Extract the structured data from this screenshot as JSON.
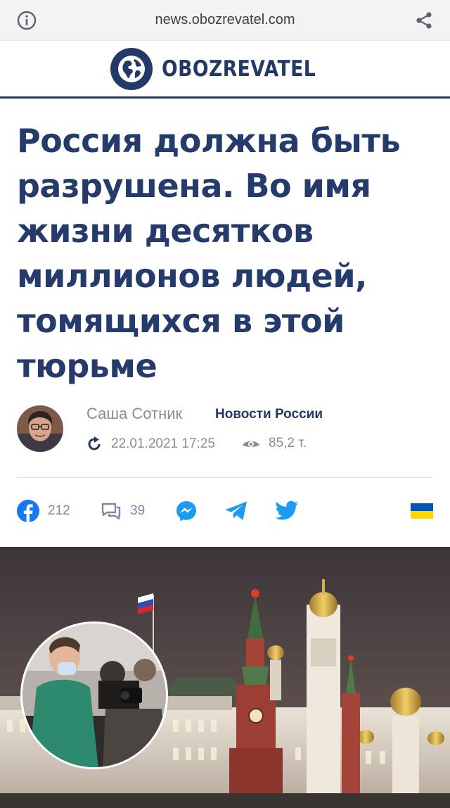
{
  "browser": {
    "url": "news.obozrevatel.com",
    "info_icon": "info-icon",
    "share_icon": "share-icon"
  },
  "site": {
    "logo_text": "OBOZREVATEL",
    "logo_icon": "globe-icon",
    "brand_color": "#243a66"
  },
  "article": {
    "title": "Россия должна быть разрушена. Во имя жизни десятков миллионов людей, томящихся в этой тюрьме",
    "author": "Саша Сотник",
    "category": "Новости России",
    "datetime": "22.01.2021 17:25",
    "views": "85,2 т."
  },
  "social": {
    "facebook_count": "212",
    "comments_count": "39",
    "messenger_icon": "messenger-icon",
    "telegram_icon": "telegram-icon",
    "twitter_icon": "twitter-icon",
    "language_flag": "ukraine-flag-icon"
  },
  "colors": {
    "headline": "#253b6b",
    "facebook": "#1877f2",
    "social_blue": "#1d9bf0",
    "flag_blue": "#0057b7",
    "flag_yellow": "#ffd700"
  }
}
